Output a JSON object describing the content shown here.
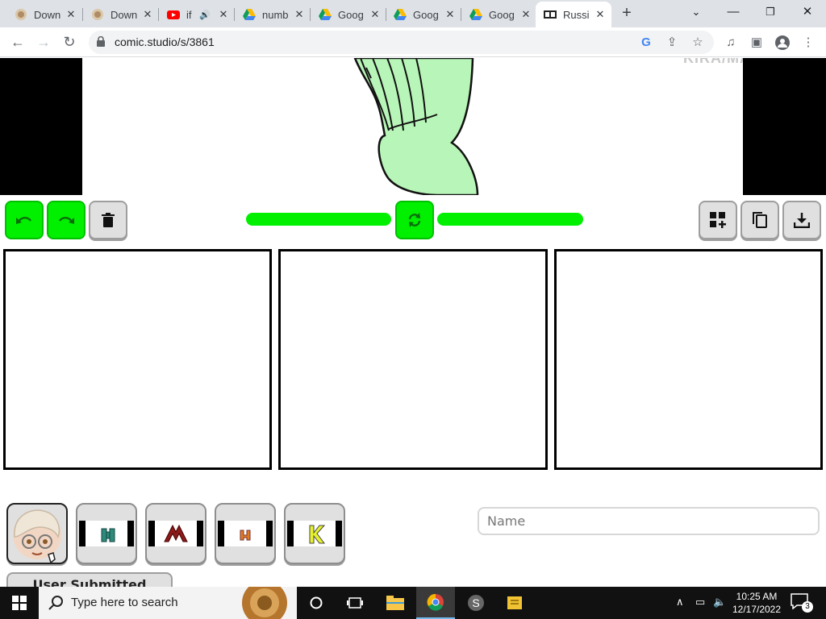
{
  "browser": {
    "tabs": [
      {
        "title": "Down",
        "icon": "pastry-icon"
      },
      {
        "title": "Down",
        "icon": "pastry-icon"
      },
      {
        "title": "if",
        "icon": "youtube-icon",
        "audio": true
      },
      {
        "title": "numb",
        "icon": "google-drive-icon"
      },
      {
        "title": "Goog",
        "icon": "google-drive-icon"
      },
      {
        "title": "Goog",
        "icon": "google-drive-icon"
      },
      {
        "title": "Goog",
        "icon": "google-drive-icon"
      },
      {
        "title": "Russi",
        "icon": "comic-studio-icon",
        "active": true
      }
    ],
    "url": "comic.studio/s/3861"
  },
  "editor": {
    "watermark": "KIRA/MASTER",
    "colors": {
      "accent_green": "#00f000",
      "button_gray": "#e0e0e0"
    },
    "toolbar_left": [
      {
        "name": "undo-button",
        "icon": "undo-icon"
      },
      {
        "name": "redo-button",
        "icon": "redo-icon"
      },
      {
        "name": "delete-button",
        "icon": "trash-icon"
      }
    ],
    "toolbar_center": {
      "icon": "refresh-icon"
    },
    "toolbar_right": [
      {
        "name": "add-panel-button",
        "icon": "grid-plus-icon"
      },
      {
        "name": "duplicate-button",
        "icon": "copy-icon"
      },
      {
        "name": "download-button",
        "icon": "download-icon"
      }
    ],
    "panels": 3,
    "sprites": [
      {
        "name": "sprite-character-avatar",
        "selected": true
      },
      {
        "name": "sprite-letter-teal"
      },
      {
        "name": "sprite-letter-maroon"
      },
      {
        "name": "sprite-letter-orange"
      },
      {
        "name": "sprite-letter-k"
      }
    ],
    "name_placeholder": "Name",
    "user_sprites_label": "User Submitted Sprites"
  },
  "taskbar": {
    "search_placeholder": "Type here to search",
    "time": "10:25 AM",
    "date": "12/17/2022",
    "notifications": "3"
  }
}
